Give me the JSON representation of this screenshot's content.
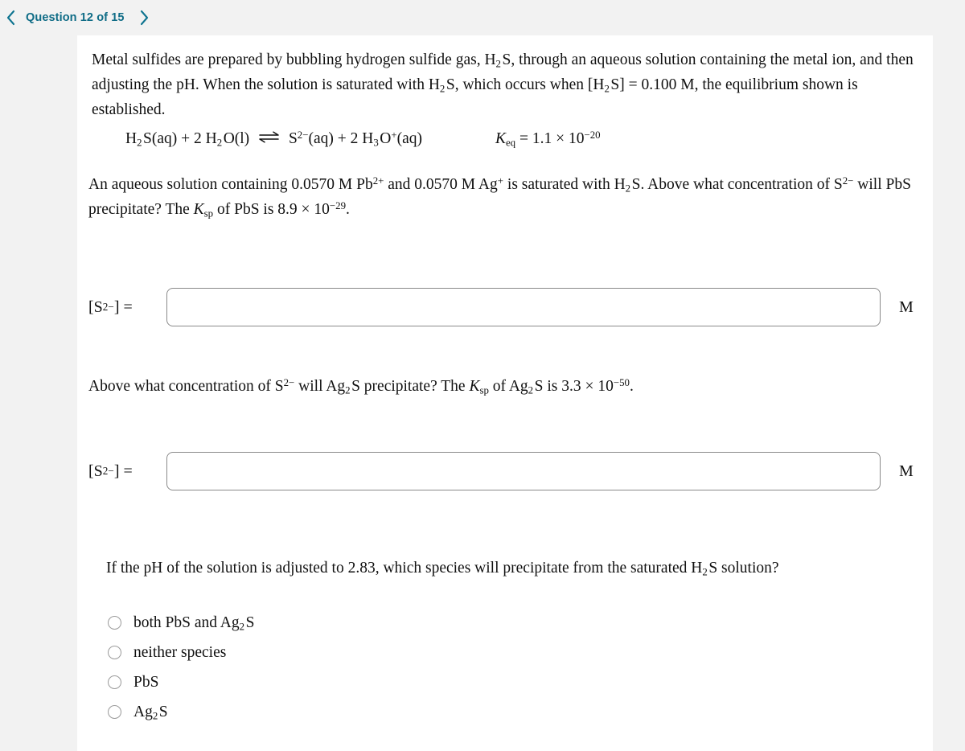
{
  "nav": {
    "prev_icon": "chevron-left-icon",
    "next_icon": "chevron-right-icon",
    "question_label": "Question 12 of 15",
    "accent_color": "#0f6c86"
  },
  "question": {
    "intro": "Metal sulfides are prepared by bubbling hydrogen sulfide gas, H2S, through an aqueous solution containing the metal ion, and then adjusting the pH. When the solution is saturated with H2S, which occurs when [H2S] = 0.100 M, the equilibrium shown is established.",
    "intro_parts": {
      "seg1": "Metal sulfides are prepared by bubbling hydrogen sulfide gas, H",
      "sub1": "2",
      "seg2": "S, through an aqueous solution containing the metal ion, and then adjusting the pH. When the solution is saturated with H",
      "sub2": "2",
      "seg3": "S, which occurs when [H",
      "sub3": "2",
      "seg4": "S] = 0.100 M, the equilibrium shown is established."
    },
    "equation": {
      "reactant1": "H",
      "reactant1_sub": "2",
      "reactant1_rest": "S(aq)",
      "plus1": "+",
      "reactant2_coeff": "2",
      "reactant2": "H",
      "reactant2_sub": "2",
      "reactant2_rest": "O(l)",
      "arrow": "equilibrium-arrow",
      "product1": "S",
      "product1_sup": "2−",
      "product1_rest": "(aq)",
      "plus2": "+",
      "product2_coeff": "2",
      "product2": "H",
      "product2_sub": "3",
      "product2_mid": "O",
      "product2_sup": "+",
      "product2_rest": "(aq)",
      "keq_symbol": "K",
      "keq_subscript": "eq",
      "keq_equals": "=",
      "keq_mantissa": "1.1 × 10",
      "keq_exponent": "−20"
    },
    "paragraph2": {
      "seg1": "An aqueous solution containing 0.0570 M Pb",
      "sup1": "2+",
      "seg2": " and 0.0570 M Ag",
      "sup2": "+",
      "seg3": " is saturated with H",
      "sub1": "2",
      "seg4": "S. Above what concentration of S",
      "sup3": "2−",
      "seg5": " will PbS precipitate? The ",
      "ksp_symbol": "K",
      "ksp_subscript": "sp",
      "seg6": " of PbS is 8.9 × 10",
      "sup4": "−29",
      "seg7": "."
    },
    "part2_prompt": {
      "seg1": "Above what concentration of S",
      "sup1": "2−",
      "seg2": " will Ag",
      "sub1": "2",
      "seg3": "S precipitate? The ",
      "ksp_symbol": "K",
      "ksp_subscript": "sp",
      "seg4": " of Ag",
      "sub2": "2",
      "seg5": "S is 3.3 × 10",
      "sup2": "−50",
      "seg6": "."
    },
    "part3_prompt": {
      "seg1": "If the pH of the solution is adjusted to 2.83, which species will precipitate from the saturated H",
      "sub1": "2",
      "seg2": "S solution?"
    }
  },
  "answers": [
    {
      "label_bracket_open": "[S",
      "label_sup": "2−",
      "label_bracket_close": "]",
      "label_equals": "=",
      "value": "",
      "placeholder": "",
      "unit": "M"
    },
    {
      "label_bracket_open": "[S",
      "label_sup": "2−",
      "label_bracket_close": "]",
      "label_equals": "=",
      "value": "",
      "placeholder": "",
      "unit": "M"
    }
  ],
  "choices": [
    {
      "id": "both",
      "text_seg1": "both PbS and Ag",
      "sub": "2",
      "text_seg2": "S",
      "selected": false
    },
    {
      "id": "neither",
      "text_seg1": "neither species",
      "sub": "",
      "text_seg2": "",
      "selected": false
    },
    {
      "id": "pbs",
      "text_seg1": "PbS",
      "sub": "",
      "text_seg2": "",
      "selected": false
    },
    {
      "id": "ag2s",
      "text_seg1": "Ag",
      "sub": "2",
      "text_seg2": "S",
      "selected": false
    }
  ]
}
